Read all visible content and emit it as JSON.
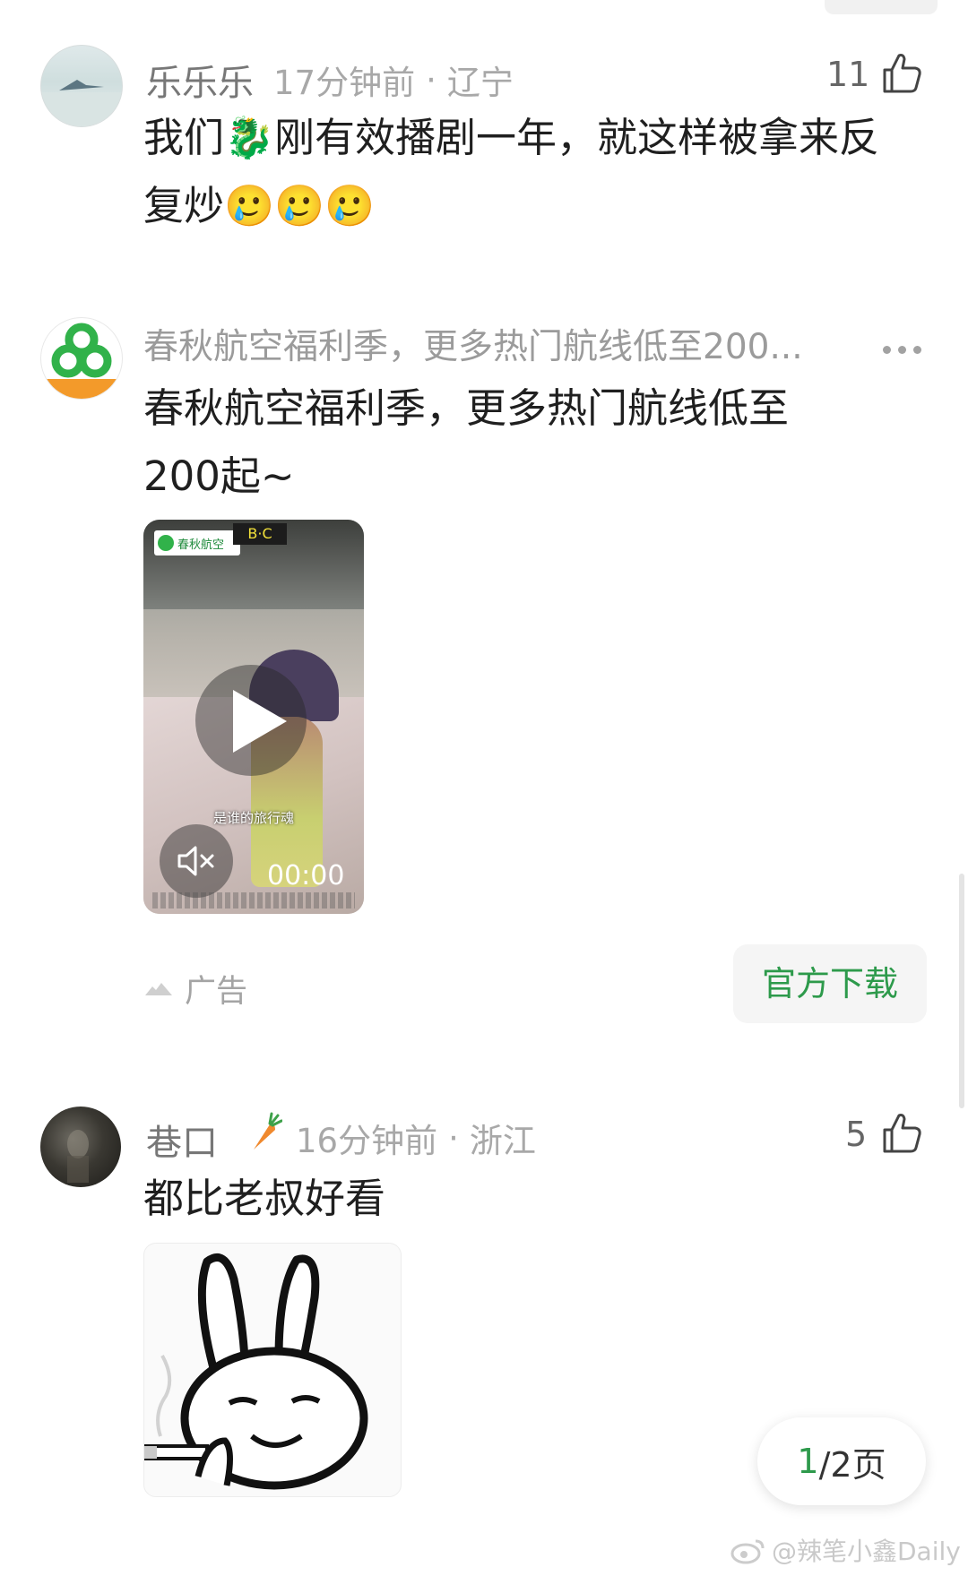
{
  "comments": [
    {
      "username": "乐乐乐",
      "time": "17分钟前",
      "location": "辽宁",
      "likes": "11",
      "text_line1": "我们🐉刚有效播剧一年，就这样被拿来反",
      "text_line2": "复炒🥲🥲🥲"
    },
    {
      "username": "巷口",
      "time": "16分钟前",
      "location": "浙江",
      "likes": "5",
      "text": "都比老叔好看"
    }
  ],
  "ad": {
    "title": "春秋航空福利季，更多热门航线低至200...",
    "text_line1": "春秋航空福利季，更多热门航线低至",
    "text_line2": "200起~",
    "video_caption": "是谁的旅行魂",
    "video_time": "00:00",
    "logo_text": "春秋航空",
    "sign_text": "B·C",
    "ad_label": "广告",
    "download_label": "官方下载"
  },
  "pager": {
    "current": "1",
    "rest": "/2页"
  },
  "watermark": "@辣笔小鑫Daily",
  "colors": {
    "accent_green": "#2e9a4c",
    "meta_gray": "#a8a8a8"
  },
  "icons": [
    "thumbs-up-icon",
    "more-dots-icon",
    "play-icon",
    "mute-icon",
    "ad-tag-icon",
    "carrot-icon",
    "weibo-icon"
  ]
}
